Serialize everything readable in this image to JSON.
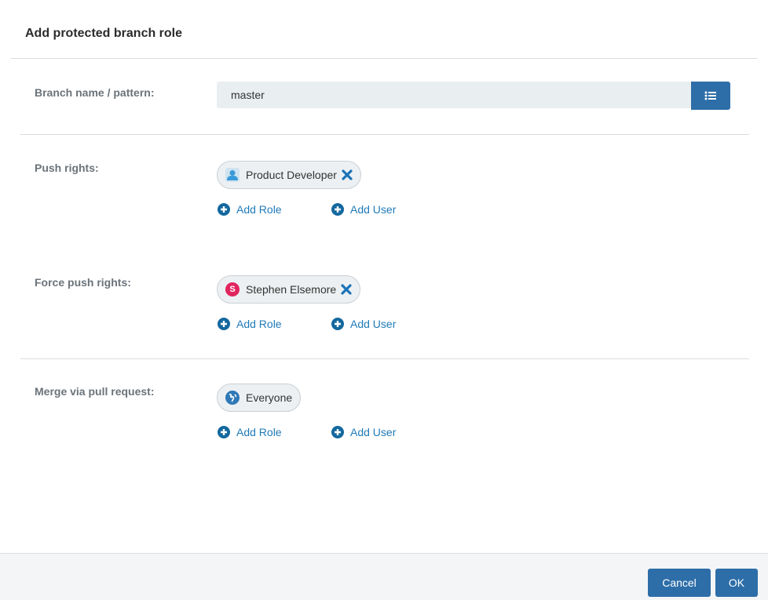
{
  "dialog": {
    "title": "Add protected branch role"
  },
  "branch": {
    "label": "Branch name / pattern:",
    "value": "master"
  },
  "push_rights": {
    "label": "Push rights:",
    "chips": [
      {
        "name": "Product Developer",
        "icon": "user-role-icon",
        "removable": true
      }
    ]
  },
  "force_push_rights": {
    "label": "Force push rights:",
    "chips": [
      {
        "name": "Stephen Elsemore",
        "icon": "user-avatar-s",
        "avatar_letter": "S",
        "avatar_color": "#e0245e",
        "removable": true
      }
    ]
  },
  "merge_via_pr": {
    "label": "Merge via pull request:",
    "chips": [
      {
        "name": "Everyone",
        "icon": "globe-icon",
        "removable": false
      }
    ]
  },
  "actions": {
    "add_role": "Add Role",
    "add_user": "Add User"
  },
  "footer": {
    "cancel": "Cancel",
    "ok": "OK"
  },
  "colors": {
    "primary": "#2d6ea8",
    "link": "#1f7ab8",
    "remove_x": "#1a73b8"
  }
}
